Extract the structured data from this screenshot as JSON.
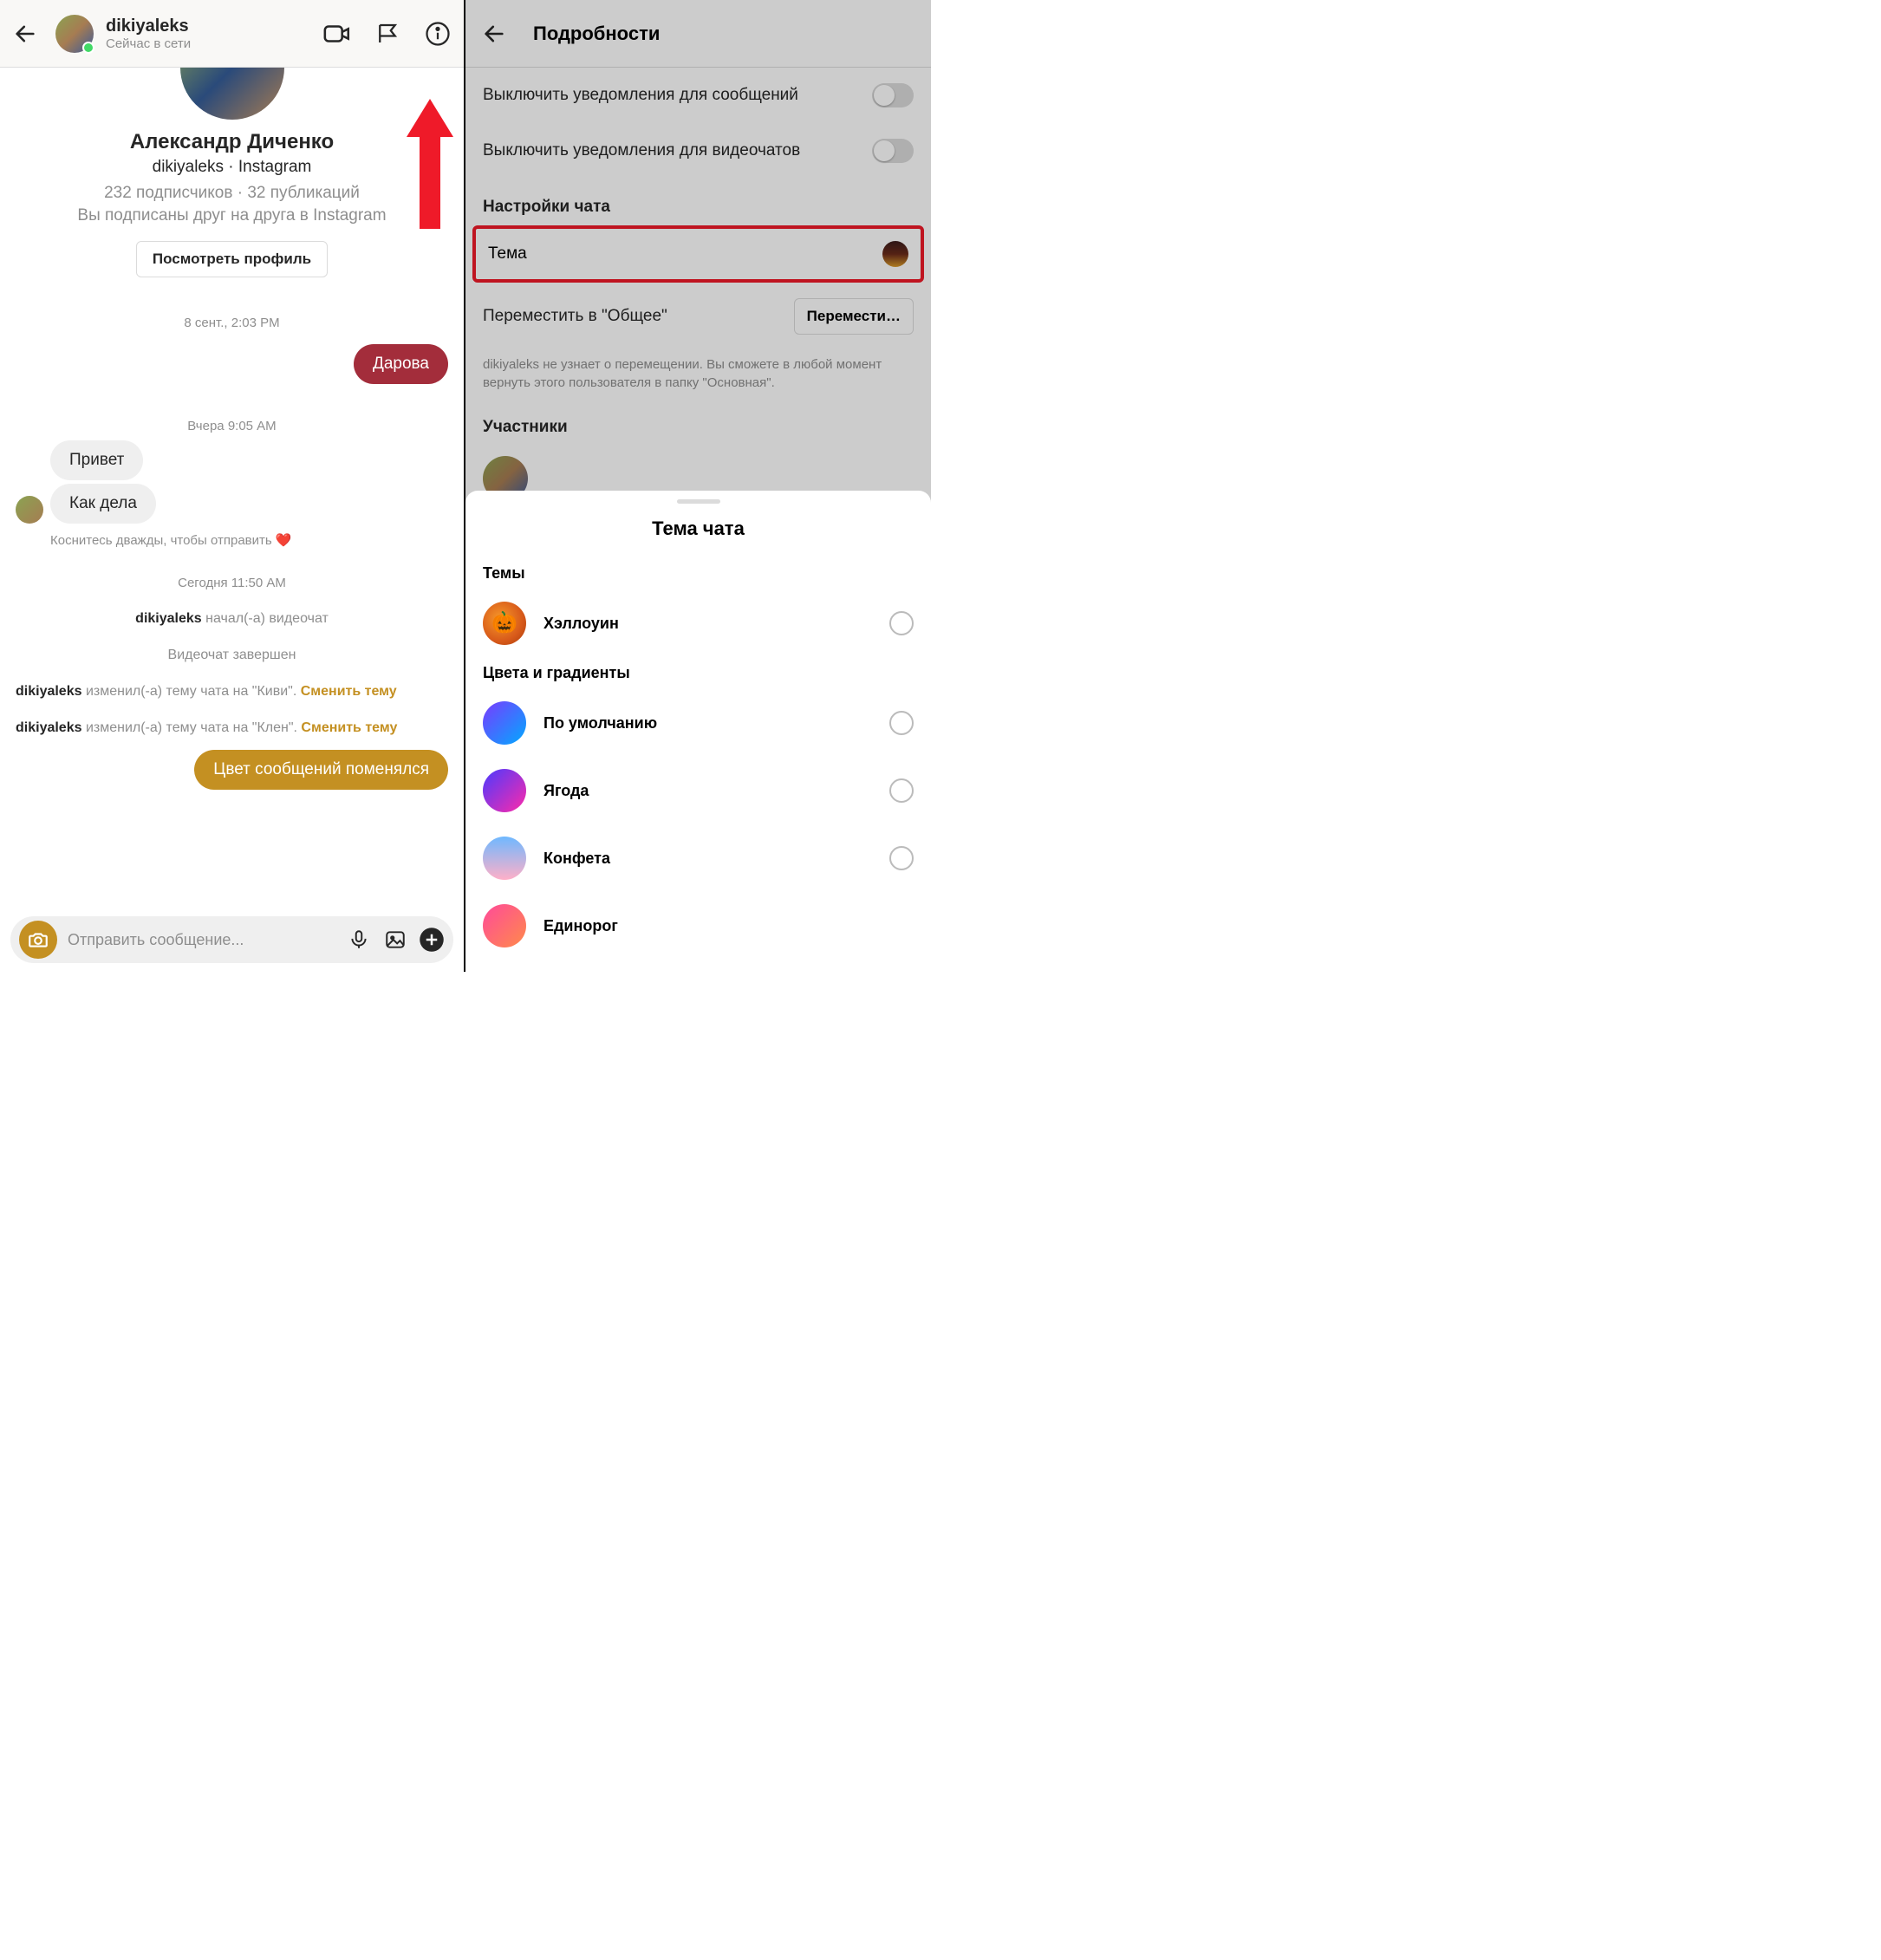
{
  "left": {
    "header": {
      "username": "dikiyaleks",
      "status": "Сейчас в сети"
    },
    "profile": {
      "full_name": "Александр Диченко",
      "handle_line": "dikiyaleks · Instagram",
      "subs_line": "232 подписчиков · 32 публикаций",
      "mutual_line": "Вы подписаны друг на друга в Instagram",
      "view_profile": "Посмотреть профиль"
    },
    "timestamps": {
      "t1": "8 сент., 2:03 PM",
      "t2": "Вчера 9:05 AM",
      "t3": "Сегодня 11:50 AM"
    },
    "messages": {
      "out1": "Дарова",
      "in1": "Привет",
      "in2": "Как дела",
      "hint": "Коснитесь дважды, чтобы отправить ❤️",
      "out2": "Цвет сообщений поменялся"
    },
    "system": {
      "vc_start_user": "dikiyaleks",
      "vc_start_text": " начал(-а) видеочат",
      "vc_end": "Видеочат завершен",
      "theme1_user": "dikiyaleks",
      "theme1_text": " изменил(-а) тему чата на \"Киви\". ",
      "theme2_user": "dikiyaleks",
      "theme2_text": " изменил(-а) тему чата на \"Клен\". ",
      "change_link": "Сменить тему"
    },
    "composer": {
      "placeholder": "Отправить сообщение..."
    }
  },
  "right": {
    "header": {
      "title": "Подробности"
    },
    "toggles": {
      "mute_msgs": "Выключить уведомления для сообщений",
      "mute_video": "Выключить уведомления для видеочатов"
    },
    "sections": {
      "chat_settings": "Настройки чата",
      "members": "Участники"
    },
    "theme_row": {
      "label": "Тема"
    },
    "move_row": {
      "label": "Переместить в \"Общее\"",
      "button": "Перемести…"
    },
    "caption": "dikiyaleks не узнает о перемещении. Вы сможете в любой момент вернуть этого пользователя в папку \"Основная\".",
    "sheet": {
      "title": "Тема чата",
      "sec_themes": "Темы",
      "sec_colors": "Цвета и градиенты",
      "items": {
        "halloween": "Хэллоуин",
        "default": "По умолчанию",
        "berry": "Ягода",
        "candy": "Конфета",
        "unicorn": "Единорог"
      }
    }
  }
}
